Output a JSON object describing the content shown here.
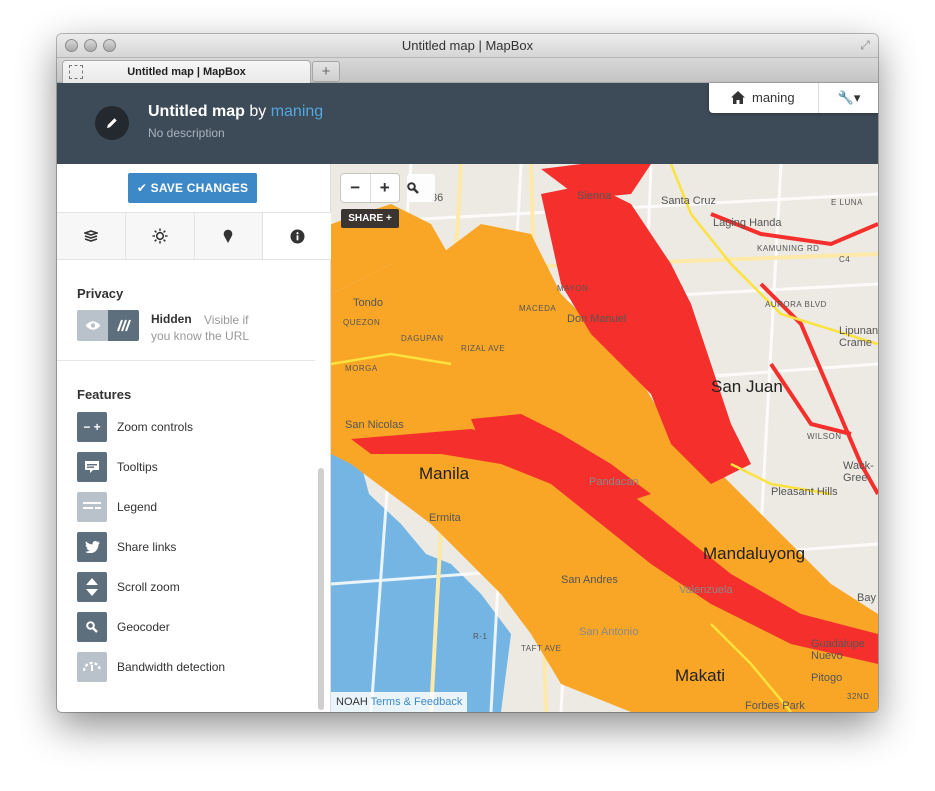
{
  "window": {
    "title": "Untitled map | MapBox",
    "tab_label": "Untitled map | MapBox",
    "new_tab_symbol": "+"
  },
  "header": {
    "map_title": "Untitled map",
    "by_text": " by ",
    "owner": "maning",
    "description": "No description",
    "user_menu_label": "maning",
    "edit_icon": "pencil-icon",
    "tools_icon": "wrench-icon"
  },
  "sidebar": {
    "save_label": "✔  SAVE CHANGES",
    "tabs": [
      {
        "name": "layers",
        "icon": "layers-icon"
      },
      {
        "name": "style",
        "icon": "sun-icon"
      },
      {
        "name": "markers",
        "icon": "marker-icon"
      },
      {
        "name": "info",
        "icon": "info-icon"
      }
    ],
    "privacy": {
      "title": "Privacy",
      "state": "Hidden",
      "note": "Visible if you know the URL"
    },
    "features": {
      "title": "Features",
      "items": [
        {
          "label": "Zoom controls",
          "icon": "zoom-controls-icon",
          "enabled": true
        },
        {
          "label": "Tooltips",
          "icon": "tooltip-icon",
          "enabled": true
        },
        {
          "label": "Legend",
          "icon": "legend-icon",
          "enabled": false
        },
        {
          "label": "Share links",
          "icon": "twitter-icon",
          "enabled": true
        },
        {
          "label": "Scroll zoom",
          "icon": "scroll-icon",
          "enabled": true
        },
        {
          "label": "Geocoder",
          "icon": "search-icon",
          "enabled": true
        },
        {
          "label": "Bandwidth detection",
          "icon": "gauge-icon",
          "enabled": false
        }
      ]
    }
  },
  "map": {
    "share_label": "SHARE +",
    "attribution_source": "NOAH",
    "attribution_link": "Terms & Feedback",
    "labels": {
      "sienna": "Sienna",
      "santa_cruz": "Santa Cruz",
      "laging_handa": "Laging Handa",
      "tondo": "Tondo",
      "don_manuel": "Don Manuel",
      "san_juan": "San Juan",
      "san_nicolas": "San Nicolas",
      "manila": "Manila",
      "pandacan": "Pandacan",
      "ermita": "Ermita",
      "pleasant_hills": "Pleasant Hills",
      "mandaluyong": "Mandaluyong",
      "san_andres": "San Andres",
      "valenzuela": "Valenzuela",
      "san_antonio": "San Antonio",
      "makati": "Makati",
      "guadalupe": "Guadalupe Nuevo",
      "pitogo": "Pitogo",
      "forbes_park": "Forbes Park",
      "bay": "Bay",
      "lipunan": "Lipunan Crame",
      "wack": "Wack-Gree",
      "kamuning_road": "KAMUNING RD",
      "aurora_road": "AURORA BLVD",
      "wilson_road": "WILSON",
      "c4_road": "C4",
      "quezon_road": "QUEZON",
      "morga_road": "MORGA",
      "dagupan_road": "DAGUPAN",
      "rizal_road": "RIZAL AVE",
      "taft_road": "TAFT AVE",
      "r1_road": "R-1",
      "mayon_road": "MAYON",
      "maceda_road": "MACEDA",
      "road_32nd": "32ND",
      "number_36": "36",
      "lunar_road": "E LUNA"
    },
    "hazard_colors": {
      "high": "#f5302c",
      "medium": "#f9a627",
      "low": "#fbe23e",
      "water": "#74b5e4"
    }
  }
}
